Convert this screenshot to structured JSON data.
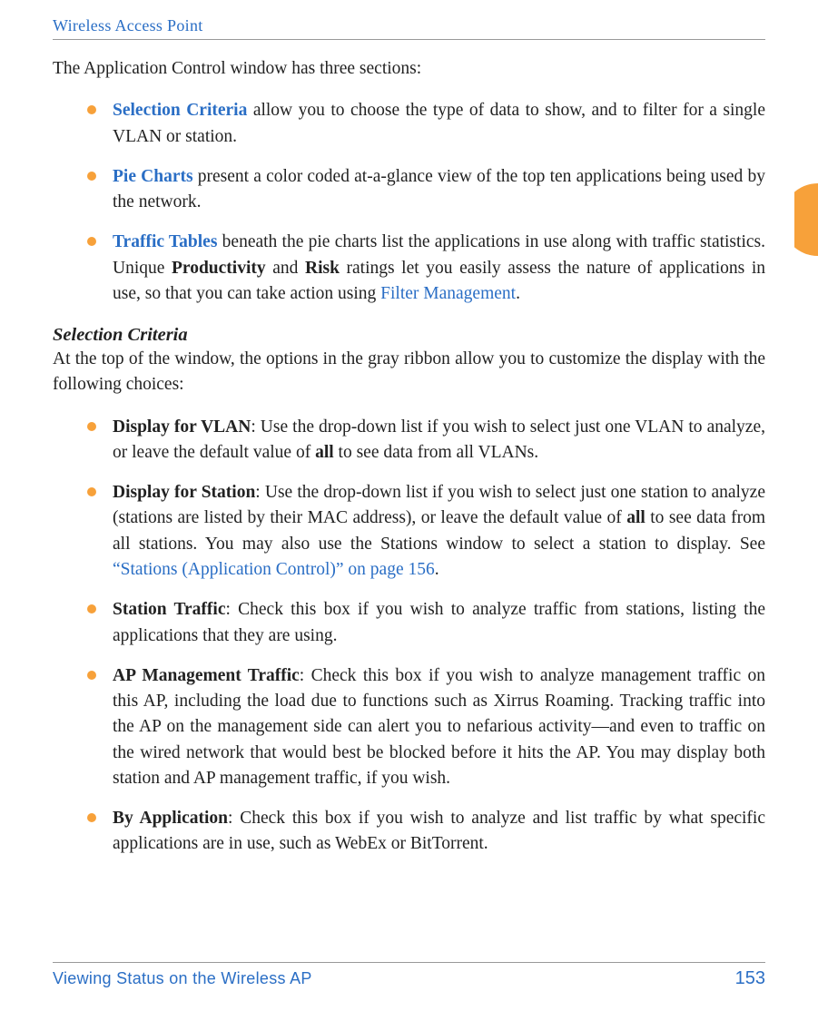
{
  "header": {
    "running_title": "Wireless Access Point"
  },
  "intro": "The Application Control window has three sections:",
  "bullets1": {
    "b1": {
      "link": "Selection Criteria",
      "rest": " allow you to choose the type of data to show, and to filter for a single VLAN or station."
    },
    "b2": {
      "link": "Pie Charts",
      "rest": " present a color coded at-a-glance view of the top ten applications being used by the network."
    },
    "b3": {
      "link": "Traffic Tables",
      "rest_a": " beneath the pie charts list the applications in use along with traffic statistics. Unique ",
      "bold1": "Productivity",
      "and": " and ",
      "bold2": "Risk",
      "rest_b": " ratings let you easily assess the nature of applications in use, so that you can take action using ",
      "link2": "Filter Management",
      "period": "."
    }
  },
  "section_heading": "Selection Criteria",
  "section_intro": "At the top of the window, the options in the gray ribbon allow you to customize the display with the following choices:",
  "bullets2": {
    "b1": {
      "title": "Display for VLAN",
      "rest_a": ": Use the drop-down list if you wish to select just one VLAN to analyze, or leave the default value of ",
      "bold1": "all",
      "rest_b": " to see data from all VLANs."
    },
    "b2": {
      "title": "Display for Station",
      "rest_a": ": Use the drop-down list if you wish to select just one station to analyze (stations are listed by their MAC address), or leave the default value of ",
      "bold1": "all",
      "rest_b": " to see data from all stations. You may also use the Stations window to select a station to display. See ",
      "link": "“Stations (Application Control)” on page 156",
      "period": "."
    },
    "b3": {
      "title": "Station Traffic",
      "rest": ": Check this box if you wish to analyze traffic from stations, listing the applications that they are using."
    },
    "b4": {
      "title": "AP Management Traffic",
      "rest": ": Check this box if you wish to analyze management traffic on this AP, including the load due to functions such as Xirrus Roaming. Tracking traffic into the AP on the management side can alert you to nefarious activity—and even to traffic on the wired network that would best be blocked before it hits the AP. You may display both station and AP management traffic, if you wish."
    },
    "b5": {
      "title": "By Application",
      "rest": ": Check this box if you wish to analyze and list traffic by what specific applications are in use, such as WebEx or BitTorrent."
    }
  },
  "footer": {
    "left": "Viewing Status on the Wireless AP",
    "page": "153"
  }
}
